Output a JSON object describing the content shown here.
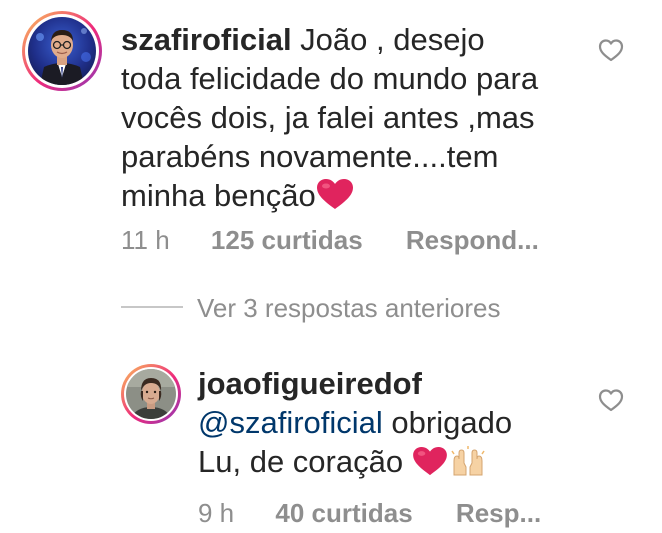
{
  "comments": [
    {
      "username": "szafiroficial",
      "text_lines": [
        " João , desejo",
        "toda felicidade do mundo para",
        "vocês dois, ja falei antes ,mas",
        "parabéns novamente....tem",
        "minha benção"
      ],
      "time": "11 h",
      "likes": "125 curtidas",
      "reply": "Respond...",
      "avatar_icon": "avatar-man-suit",
      "like_icon": "heart-outline-icon"
    }
  ],
  "view_replies": "Ver 3 respostas anteriores",
  "reply": {
    "username": "joaofigueiredof",
    "mention": "@szafiroficial",
    "text_after_mention": " obrigado",
    "text_line2": "Lu, de coração ",
    "time": "9 h",
    "likes": "40 curtidas",
    "reply": "Resp...",
    "avatar_icon": "avatar-young-man",
    "like_icon": "heart-outline-icon"
  },
  "colors": {
    "text": "#262626",
    "meta": "#8e8e8e",
    "mention": "#00376b",
    "heart_emoji": "#e0245e",
    "ring_start": "#f9c25a",
    "ring_end": "#8a3ab9"
  }
}
